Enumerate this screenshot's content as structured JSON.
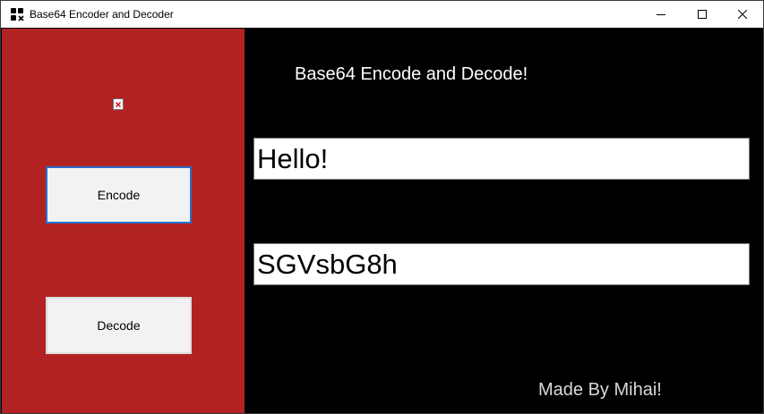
{
  "window": {
    "title": "Base64 Encoder and Decoder",
    "icons": {
      "app": "app-icon",
      "minimize": "minimize-icon",
      "maximize": "maximize-icon",
      "close": "close-icon"
    }
  },
  "sidebar": {
    "background": "#b22222",
    "image_icon": "broken-image-icon",
    "encode_label": "Encode",
    "decode_label": "Decode"
  },
  "main": {
    "background": "#000000",
    "heading": "Base64 Encode and Decode!",
    "input_value": "Hello!",
    "output_value": "SGVsbG8h",
    "footer": "Made By Mihai!"
  }
}
